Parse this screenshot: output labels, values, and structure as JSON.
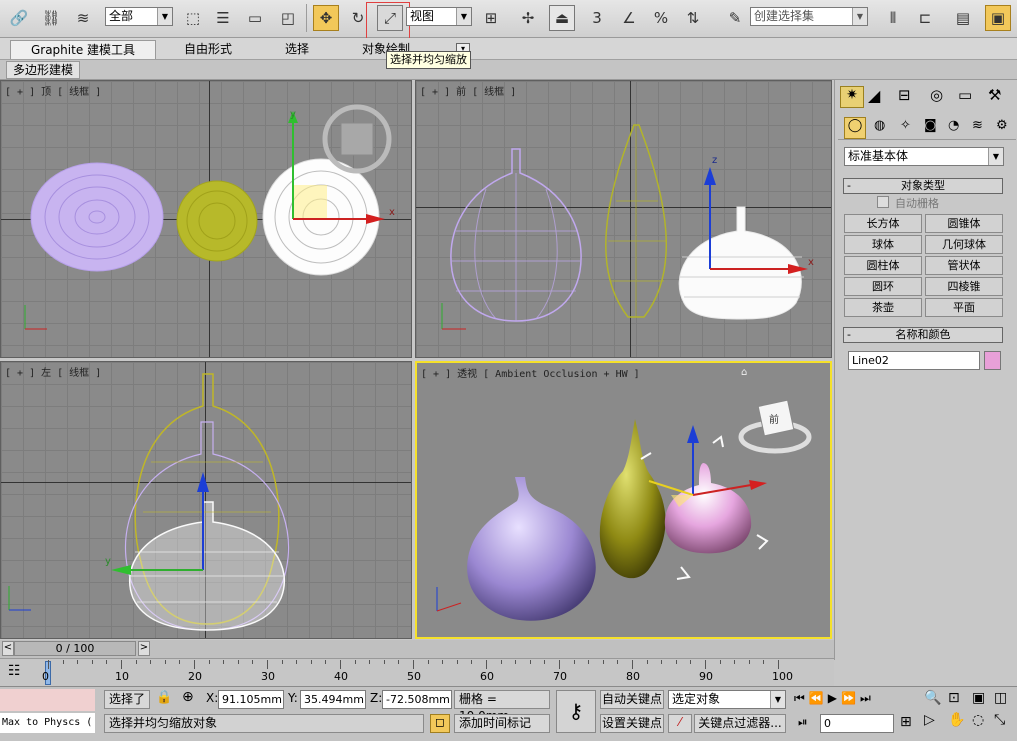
{
  "toolbar": {
    "selection_filter": "全部",
    "ref_coord": "视图",
    "named_selection_placeholder": "创建选择集",
    "tooltip": "选择并均匀缩放"
  },
  "ribbon": {
    "tabs": [
      "Graphite 建模工具",
      "自由形式",
      "选择",
      "对象绘制"
    ],
    "sub_tab": "多边形建模"
  },
  "viewports": {
    "top": "[ + ] 顶 [ 线框 ]",
    "front": "[ + ] 前 [ 线框 ]",
    "left": "[ + ] 左 [ 线框 ]",
    "perspective": "[ + ] 透视 [ Ambient Occlusion + HW ]",
    "axis_x": "x",
    "axis_y": "y",
    "axis_z": "z",
    "viewcube_face": "前"
  },
  "command_panel": {
    "category": "标准基本体",
    "object_type_title": "对象类型",
    "autogrid": "自动栅格",
    "buttons": [
      "长方体",
      "圆锥体",
      "球体",
      "几何球体",
      "圆柱体",
      "管状体",
      "圆环",
      "四棱锥",
      "茶壶",
      "平面"
    ],
    "name_color_title": "名称和颜色",
    "object_name": "Line02",
    "object_color": "#e8a0d8"
  },
  "timeline": {
    "frame_display": "0 / 100",
    "ticks": [
      "0",
      "10",
      "20",
      "30",
      "40",
      "50",
      "60",
      "70",
      "80",
      "90",
      "100"
    ]
  },
  "status": {
    "maxscript": "Max to Physcs (",
    "selected": "选择了",
    "prompt": "选择并均匀缩放对象",
    "x_label": "X:",
    "x_value": "91.105mm",
    "y_label": "Y:",
    "y_value": "35.494mm",
    "z_label": "Z:",
    "z_value": "-72.508mm",
    "grid": "栅格 = 10.0mm",
    "add_time_tag": "添加时间标记",
    "auto_key": "自动关键点",
    "set_key": "设置关键点",
    "selected_object": "选定对象",
    "key_filters": "关键点过滤器...",
    "current_frame": "0"
  }
}
